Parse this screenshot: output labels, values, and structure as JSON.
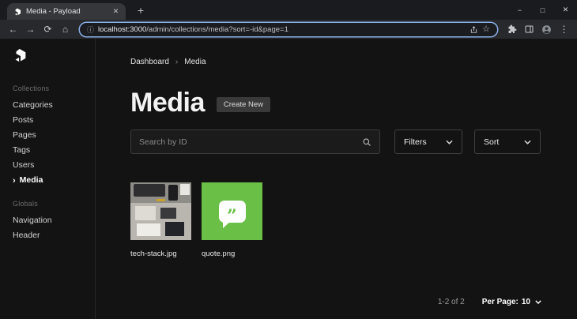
{
  "icons": {
    "tab_close": "✕",
    "new_tab": "+",
    "minimize": "−",
    "maximize": "□",
    "close": "✕",
    "back": "←",
    "forward": "→",
    "reload": "⟳",
    "home": "⌂",
    "info": "ⓘ",
    "bookmark_star": "☆",
    "menu_dots": "⋮",
    "chevron_right": "›"
  },
  "browser": {
    "tab_title": "Media - Payload",
    "url_host": "localhost:3000",
    "url_path": "/admin/collections/media?sort=-id&page=1"
  },
  "sidebar": {
    "collections_label": "Collections",
    "items": [
      {
        "label": "Categories"
      },
      {
        "label": "Posts"
      },
      {
        "label": "Pages"
      },
      {
        "label": "Tags"
      },
      {
        "label": "Users"
      },
      {
        "label": "Media",
        "active": true
      }
    ],
    "globals_label": "Globals",
    "globals": [
      {
        "label": "Navigation"
      },
      {
        "label": "Header"
      }
    ]
  },
  "breadcrumb": {
    "dashboard": "Dashboard",
    "current": "Media"
  },
  "page": {
    "title": "Media",
    "create_new": "Create New",
    "search_placeholder": "Search by ID",
    "filters": "Filters",
    "sort": "Sort"
  },
  "media_items": [
    {
      "filename": "tech-stack.jpg"
    },
    {
      "filename": "quote.png",
      "accent": "#6abf47",
      "glyph": "”"
    }
  ],
  "pagination": {
    "range": "1-2 of 2",
    "per_page_label": "Per Page:",
    "per_page_value": "10"
  }
}
